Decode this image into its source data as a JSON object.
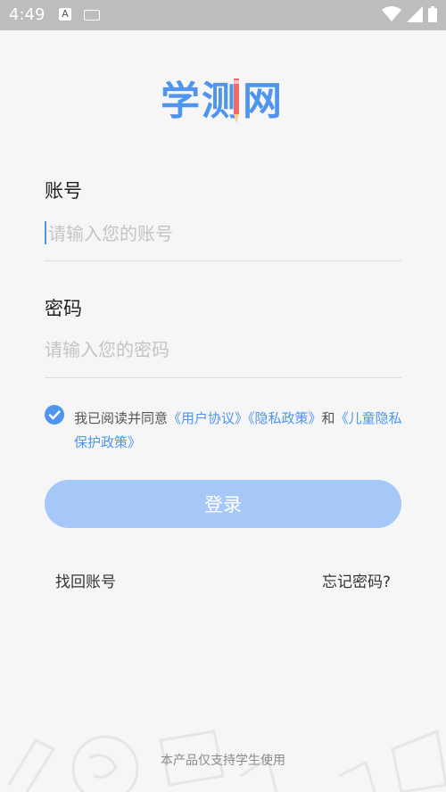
{
  "status_bar": {
    "time": "4:49",
    "a_badge": "A"
  },
  "app": {
    "logo": "学测网"
  },
  "account": {
    "label": "账号",
    "placeholder": "请输入您的账号"
  },
  "password": {
    "label": "密码",
    "placeholder": "请输入您的密码"
  },
  "agreement": {
    "prefix": "我已阅读并同意",
    "user_agreement": "《用户协议》",
    "privacy_policy": "《隐私政策》",
    "and": "和",
    "child_privacy": "《儿童隐私保护政策》",
    "checked": true
  },
  "actions": {
    "login": "登录",
    "recover_account": "找回账号",
    "forgot_password": "忘记密码?"
  },
  "footer": {
    "note": "本产品仅支持学生使用"
  },
  "colors": {
    "accent": "#4f95ee",
    "button_disabled": "#a5c8f8",
    "status_bar": "#bdbdbd"
  }
}
